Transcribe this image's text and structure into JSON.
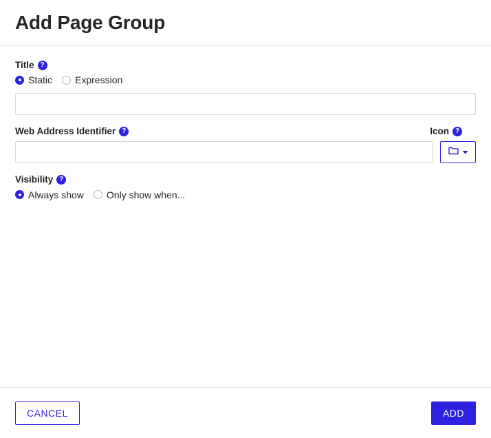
{
  "dialog": {
    "title": "Add Page Group"
  },
  "fields": {
    "title": {
      "label": "Title",
      "help_icon": "?",
      "help_icon_name": "help-icon",
      "value": "",
      "placeholder": "",
      "options": [
        {
          "label": "Static",
          "selected": true
        },
        {
          "label": "Expression",
          "selected": false
        }
      ]
    },
    "web_address_identifier": {
      "label": "Web Address Identifier",
      "help_icon": "?",
      "value": "",
      "placeholder": ""
    },
    "icon": {
      "label": "Icon",
      "help_icon": "?",
      "glyph_name": "folder-icon",
      "caret_name": "chevron-down-icon"
    },
    "visibility": {
      "label": "Visibility",
      "help_icon": "?",
      "options": [
        {
          "label": "Always show",
          "selected": true
        },
        {
          "label": "Only show when...",
          "selected": false
        }
      ]
    }
  },
  "footer": {
    "cancel_label": "CANCEL",
    "add_label": "ADD"
  },
  "colors": {
    "accent": "#2d22e0",
    "title_text": "#262626",
    "border": "#d8d8d8",
    "divider": "#dcdcdc",
    "white": "#ffffff"
  }
}
